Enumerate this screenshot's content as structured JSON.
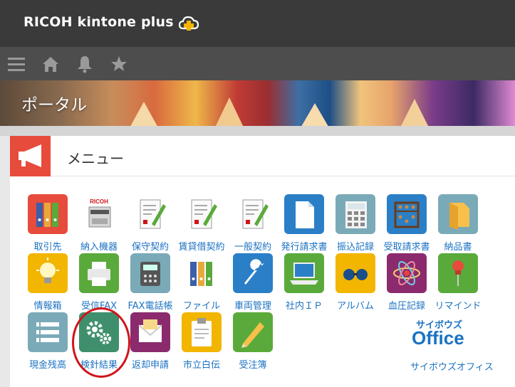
{
  "header": {
    "brand": "RICOH kintone plus"
  },
  "toolbar": {
    "icons": [
      "menu-icon",
      "home-icon",
      "bell-icon",
      "star-icon"
    ]
  },
  "banner": {
    "title": "ポータル"
  },
  "menu": {
    "title": "メニュー"
  },
  "apps": [
    {
      "label": "取引先",
      "icon": "binders-icon",
      "color": "#e64b3c"
    },
    {
      "label": "納入機器",
      "icon": "copier-icon",
      "color": "#ffffff"
    },
    {
      "label": "保守契約",
      "icon": "contract-icon",
      "color": "#ffffff"
    },
    {
      "label": "賃貸借契約",
      "icon": "contract-icon",
      "color": "#ffffff"
    },
    {
      "label": "一般契約",
      "icon": "contract-icon",
      "color": "#ffffff"
    },
    {
      "label": "発行請求書",
      "icon": "document-icon",
      "color": "#2a7fc7"
    },
    {
      "label": "振込記録",
      "icon": "calculator-icon",
      "color": "#7aaab8"
    },
    {
      "label": "受取請求書",
      "icon": "abacus-icon",
      "color": "#2a7fc7"
    },
    {
      "label": "納品書",
      "icon": "folder-icon",
      "color": "#7aaab8"
    },
    {
      "label": "情報箱",
      "icon": "lightbulb-icon",
      "color": "#f2b500"
    },
    {
      "label": "受信FAX",
      "icon": "printer-icon",
      "color": "#5aaa3b"
    },
    {
      "label": "FAX電話帳",
      "icon": "fax-phone-icon",
      "color": "#7aaab8"
    },
    {
      "label": "ファイル",
      "icon": "binders-icon",
      "color": "#ffffff"
    },
    {
      "label": "車両管理",
      "icon": "wrench-icon",
      "color": "#2a7fc7"
    },
    {
      "label": "社内ＩＰ",
      "icon": "laptop-icon",
      "color": "#5aaa3b"
    },
    {
      "label": "アルバム",
      "icon": "glasses-icon",
      "color": "#f2b500"
    },
    {
      "label": "血圧記録",
      "icon": "atom-icon",
      "color": "#8b2b6e"
    },
    {
      "label": "リマインド",
      "icon": "pushpin-icon",
      "color": "#5aaa3b"
    },
    {
      "label": "現金残高",
      "icon": "list-icon",
      "color": "#7aaab8"
    },
    {
      "label": "検針結果",
      "icon": "gears-icon",
      "color": "#3f8f6c"
    },
    {
      "label": "返却申請",
      "icon": "envelope-icon",
      "color": "#8b2b6e"
    },
    {
      "label": "市立白伝",
      "icon": "clipboard-icon",
      "color": "#f2b500"
    },
    {
      "label": "受注簿",
      "icon": "pencil-icon",
      "color": "#5aaa3b"
    }
  ],
  "cybozu": {
    "logo_top": "サイボウズ",
    "logo_main": "Office",
    "label": "サイボウズオフィス",
    "color": "#1b72c2"
  },
  "copier_brand": "RICOH"
}
